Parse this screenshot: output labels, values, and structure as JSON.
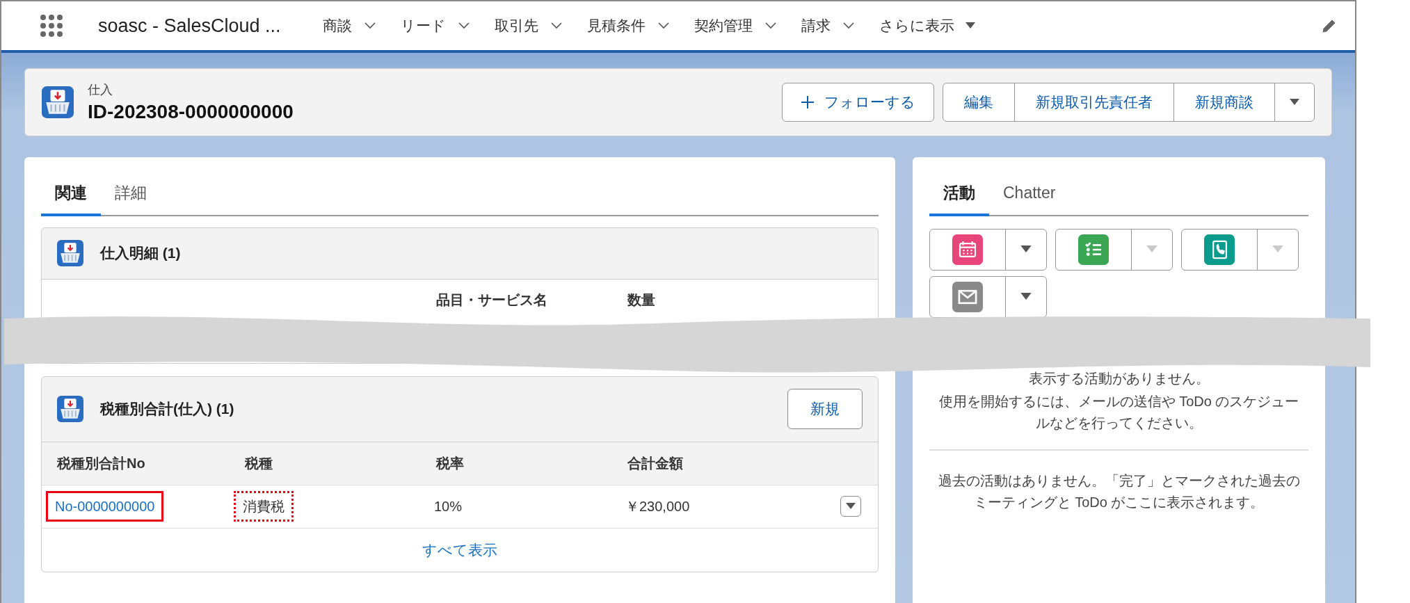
{
  "nav": {
    "app_name": "soasc - SalesCloud ...",
    "items": [
      {
        "label": "商談"
      },
      {
        "label": "リード"
      },
      {
        "label": "取引先"
      },
      {
        "label": "見積条件"
      },
      {
        "label": "契約管理"
      },
      {
        "label": "請求"
      }
    ],
    "more": "さらに表示"
  },
  "record": {
    "type": "仕入",
    "title": "ID-202308-0000000000",
    "follow_button": "フォローする",
    "actions": [
      "編集",
      "新規取引先責任者",
      "新規商談"
    ]
  },
  "left_tabs": [
    {
      "label": "関連",
      "selected": true
    },
    {
      "label": "詳細",
      "selected": false
    }
  ],
  "purchase_lines": {
    "title": "仕入明細 (1)",
    "columns": [
      "品目・サービス名",
      "数量"
    ]
  },
  "tax_totals": {
    "title": "税種別合計(仕入) (1)",
    "new_button": "新規",
    "columns": [
      "税種別合計No",
      "税種",
      "税率",
      "合計金額"
    ],
    "rows": [
      {
        "cells": [
          {
            "text": "No-0000000000",
            "kind": "link",
            "highlighted": true,
            "dotted": false
          },
          {
            "text": "消費税",
            "kind": "text",
            "highlighted": false,
            "dotted": true
          },
          {
            "text": "10%",
            "kind": "text",
            "highlighted": false,
            "dotted": false
          },
          {
            "text": "￥230,000",
            "kind": "text",
            "highlighted": false,
            "dotted": false
          }
        ]
      }
    ],
    "show_all": "すべて表示"
  },
  "right_tabs": [
    {
      "label": "活動",
      "selected": true
    },
    {
      "label": "Chatter",
      "selected": false
    }
  ],
  "activity_buttons": [
    {
      "kind": "event",
      "color": "#e9457a",
      "disabled": false
    },
    {
      "kind": "task",
      "color": "#3ba755",
      "disabled": true
    },
    {
      "kind": "call",
      "color": "#0b9c8e",
      "disabled": true
    },
    {
      "kind": "email",
      "color": "#8a8a8a",
      "disabled": false
    }
  ],
  "upcoming": [
    "表示する活動がありません。",
    "使用を開始するには、メールの送信や ToDo のスケジュールなどを行ってください。"
  ],
  "past": "過去の活動はありません。「完了」とマークされた過去のミーティングと ToDo がここに表示されます。"
}
